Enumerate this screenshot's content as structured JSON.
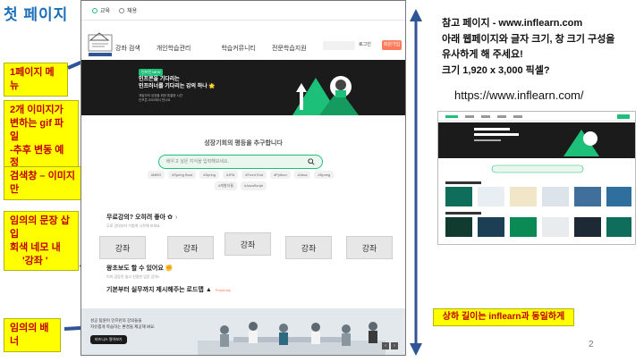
{
  "slide": {
    "title": "첫 페이지",
    "page_number": "2"
  },
  "notes": {
    "menu": "1페이지 메뉴",
    "gif": [
      "2개 이미지가",
      "변하는 gif 파일",
      "-추후 변동 예정"
    ],
    "search": "검색창 – 이미지만",
    "sentence": [
      "임의의 문장 삽입",
      "회색 네모 내",
      "'강좌 '"
    ],
    "banner": "임의의 배너",
    "height": "상하 길이는 inflearn과 동일하게"
  },
  "reference": {
    "lines": [
      "참고 페이지 - www.inflearn.com",
      "아래 웹페이지와 글자 크기, 창 크기 구성을",
      "유사하게 해 주세요!",
      "크기 1,920 x 3,000 픽셀?"
    ],
    "url": "https://www.inflearn.com/"
  },
  "mockup": {
    "topbar": {
      "tab1": "교육",
      "tab2": "채용"
    },
    "nav": {
      "items": [
        "강좌 검색",
        "개인학습관리",
        "학습커뮤니티",
        "전문학습지원"
      ],
      "login": "로그인",
      "join": "회원가입"
    },
    "hero": {
      "badge": "인프런 NEW",
      "title_lines": [
        "인프콘을 기다리는",
        "인프러너를 기다리는 강의 하나 🌟"
      ],
      "desc_lines": [
        "개발자의 성장을 위한 특별한 시간",
        "인프콘 2022에서 만나요"
      ]
    },
    "section_title": "성장기회의 평등을 추구합니다",
    "search_placeholder": "배우고 싶은 지식을 입력해보세요.",
    "tags": [
      "#MBO",
      "#Spring Boot",
      "#Spring",
      "#JPA",
      "#Front End",
      "#Python",
      "#Java",
      "#Spring",
      "#개발자들",
      "#JavaScript"
    ],
    "row1": {
      "title": "무료강의? 오히려 좋아",
      "sub": "무료 강의부터 가볍게 시작해 보세요."
    },
    "course_label": "강좌",
    "cards_count": 5,
    "row2": {
      "title": "왕초보도 할 수 있어요",
      "sub": "이미 검증된 쉽고 친절한 입문 강의!!"
    },
    "row3": {
      "title": "기본부터 실무까지 제시해주는 로드맵",
      "badge": "Roadmap"
    },
    "banner": {
      "lines": [
        "성공 팀원이 인프런의 강의들을",
        "자유롭게 학습하는 환경을 제공해 봐요."
      ],
      "button": "비즈니스 알아보기",
      "nav_prev": "‹",
      "nav_next": "›"
    }
  },
  "colors": {
    "note_bg": "#ffff00",
    "note_text": "#c00000",
    "arrow": "#2f5597",
    "brand_green": "#1dc078",
    "title_blue": "#1c6fb8"
  }
}
